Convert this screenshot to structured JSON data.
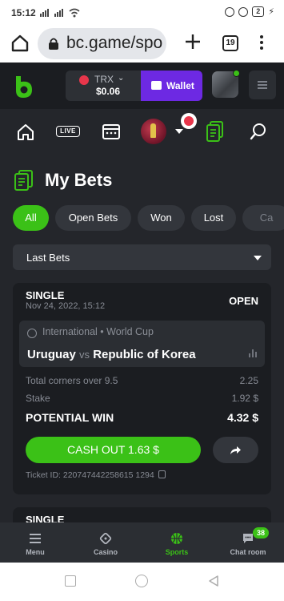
{
  "status_bar": {
    "time": "15:12",
    "battery": "2"
  },
  "browser": {
    "url": "bc.game/spo",
    "tab_count": "19"
  },
  "header": {
    "balance_currency": "TRX",
    "balance_amount": "$0.06",
    "wallet_label": "Wallet"
  },
  "nav": {
    "live_label": "LIVE"
  },
  "page": {
    "title": "My Bets"
  },
  "filters": {
    "tabs": [
      "All",
      "Open Bets",
      "Won",
      "Lost",
      "Ca"
    ],
    "active_index": 0
  },
  "dropdown": {
    "selected": "Last Bets"
  },
  "bet": {
    "type": "SINGLE",
    "date": "Nov 24, 2022, 15:12",
    "status": "OPEN",
    "league": "International • World Cup",
    "home_team": "Uruguay",
    "vs": "vs",
    "away_team": "Republic of Korea",
    "selection_label": "Total corners over 9.5",
    "odds": "2.25",
    "stake_label": "Stake",
    "stake_value": "1.92 $",
    "potential_label": "POTENTIAL WIN",
    "potential_value": "4.32 $",
    "cashout_label": "CASH OUT 1.63 $",
    "ticket_label": "Ticket ID: 220747442258615 1294"
  },
  "bet2": {
    "type": "SINGLE"
  },
  "bottom_tabs": [
    {
      "label": "Menu",
      "icon": "menu-icon"
    },
    {
      "label": "Casino",
      "icon": "casino-icon"
    },
    {
      "label": "Sports",
      "icon": "sports-icon"
    },
    {
      "label": "Chat room",
      "icon": "chat-icon"
    }
  ],
  "chat_badge": "38",
  "colors": {
    "accent": "#3bc117",
    "wallet": "#6d29e3",
    "background": "#24262b"
  }
}
